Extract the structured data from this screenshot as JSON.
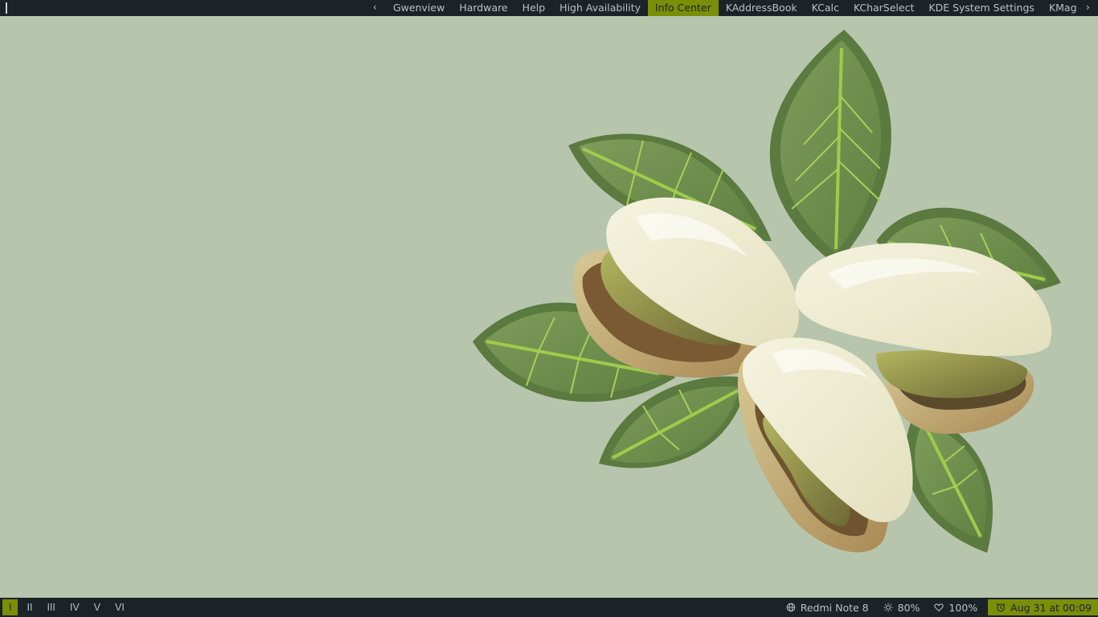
{
  "topbar": {
    "prev_arrow": "‹",
    "next_arrow": "›",
    "tasks": [
      {
        "label": "Gwenview"
      },
      {
        "label": "Hardware"
      },
      {
        "label": "Help"
      },
      {
        "label": "High Availability"
      },
      {
        "label": "Info Center",
        "active": true
      },
      {
        "label": "KAddressBook"
      },
      {
        "label": "KCalc"
      },
      {
        "label": "KCharSelect"
      },
      {
        "label": "KDE System Settings"
      },
      {
        "label": "KMag"
      }
    ]
  },
  "bottombar": {
    "desktops": [
      "I",
      "II",
      "III",
      "IV",
      "V",
      "VI"
    ],
    "active_desktop": "I",
    "status": {
      "network": "Redmi Note 8",
      "brightness": "80%",
      "volume": "100%",
      "clock": "Aug 31 at 00:09"
    }
  },
  "colors": {
    "bar_bg": "#1b2228",
    "accent": "#7b8e07",
    "wallpaper_bg": "#b7c5ad"
  },
  "icons": {
    "network": "globe-icon",
    "brightness": "sun-icon",
    "volume": "heart-icon",
    "clock": "alarm-clock-icon"
  }
}
